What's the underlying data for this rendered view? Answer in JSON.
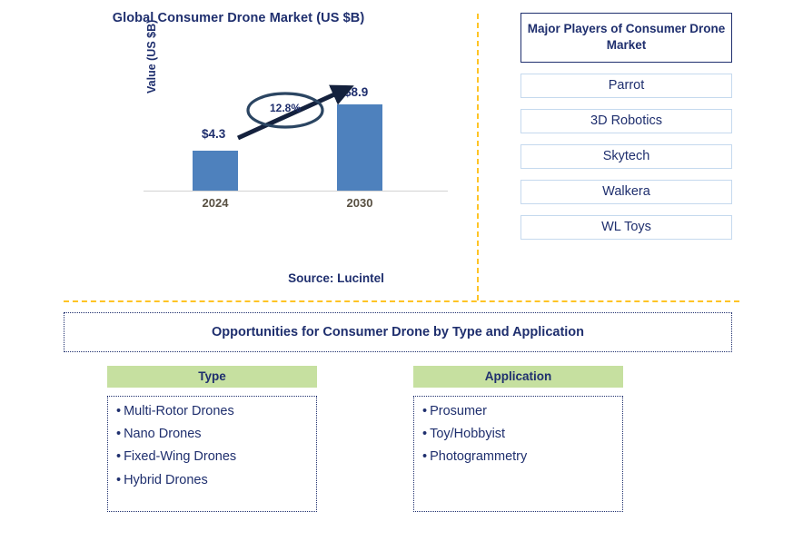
{
  "chart_panel": {
    "title": "Global Consumer Drone Market (US $B)",
    "source": "Source: Lucintel"
  },
  "chart_data": {
    "type": "bar",
    "title": "Global Consumer Drone Market (US $B)",
    "xlabel": "",
    "ylabel": "Value (US $B)",
    "categories": [
      "2024",
      "2030"
    ],
    "values": [
      4.3,
      8.9
    ],
    "value_labels": [
      "$4.3",
      "$8.9"
    ],
    "annotation": "12.8%",
    "annotation_type": "cagr-ellipse-with-arrow",
    "ylim": [
      0,
      10
    ],
    "grid": false,
    "legend": "none",
    "series_color": "#4e81bd"
  },
  "players": {
    "title": "Major Players of Consumer Drone Market",
    "items": [
      {
        "name": "Parrot"
      },
      {
        "name": "3D Robotics"
      },
      {
        "name": "Skytech"
      },
      {
        "name": "Walkera"
      },
      {
        "name": "WL Toys"
      }
    ]
  },
  "opportunities": {
    "heading": "Opportunities for Consumer Drone by Type and Application",
    "columns": [
      {
        "header": "Type",
        "items": [
          "Multi-Rotor Drones",
          "Nano Drones",
          "Fixed-Wing Drones",
          "Hybrid Drones"
        ]
      },
      {
        "header": "Application",
        "items": [
          "Prosumer",
          "Toy/Hobbyist",
          "Photogrammetry"
        ]
      }
    ]
  },
  "colors": {
    "bar": "#4e81bd",
    "navy": "#1f2f6e",
    "divider_orange": "#ffc425",
    "header_green": "#c6e0a0",
    "player_border": "#c5d9ee"
  }
}
